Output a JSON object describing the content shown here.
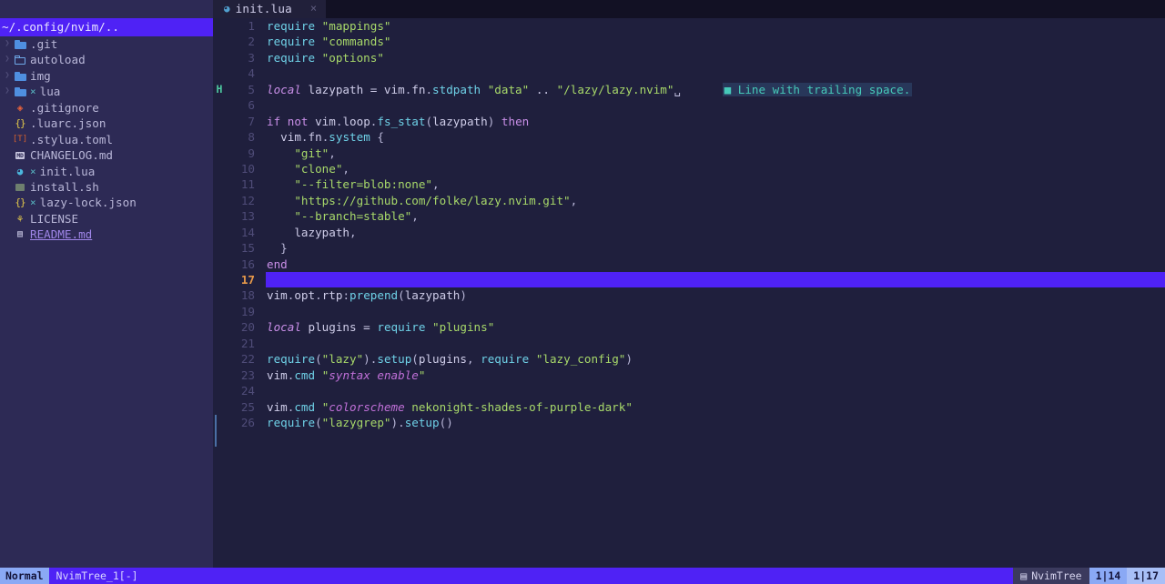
{
  "tabline": {
    "tab": {
      "icon": "lua-file-icon",
      "glyph": "◕",
      "label": "init.lua",
      "close": "×"
    }
  },
  "sidebar": {
    "root": "~/.config/nvim/..",
    "items": [
      {
        "arrow": "❯",
        "icon": "folder-closed-icon",
        "kind": "folder-full",
        "label": ".git",
        "modified": ""
      },
      {
        "arrow": "❯",
        "icon": "folder-open-icon",
        "kind": "folder-open",
        "label": "autoload",
        "modified": ""
      },
      {
        "arrow": "❯",
        "icon": "folder-closed-icon",
        "kind": "folder-full",
        "label": "img",
        "modified": ""
      },
      {
        "arrow": "❯",
        "icon": "folder-closed-icon",
        "kind": "folder-full",
        "label": "lua",
        "modified": "×"
      },
      {
        "arrow": "",
        "icon": "git-icon",
        "kind": "git",
        "label": ".gitignore",
        "modified": "",
        "glyph": "◈"
      },
      {
        "arrow": "",
        "icon": "json-icon",
        "kind": "json",
        "label": ".luarc.json",
        "modified": "",
        "glyph": "{}"
      },
      {
        "arrow": "",
        "icon": "toml-icon",
        "kind": "toml",
        "label": ".stylua.toml",
        "modified": "",
        "glyph": "[T]"
      },
      {
        "arrow": "",
        "icon": "markdown-icon",
        "kind": "md",
        "label": "CHANGELOG.md",
        "modified": "",
        "glyph": "MD"
      },
      {
        "arrow": "",
        "icon": "lua-file-icon",
        "kind": "lua",
        "label": "init.lua",
        "modified": "×",
        "glyph": "◕"
      },
      {
        "arrow": "",
        "icon": "shell-script-icon",
        "kind": "sh",
        "label": "install.sh",
        "modified": "",
        "glyph": ""
      },
      {
        "arrow": "",
        "icon": "json-icon",
        "kind": "json",
        "label": "lazy-lock.json",
        "modified": "×",
        "glyph": "{}"
      },
      {
        "arrow": "",
        "icon": "license-icon",
        "kind": "lic",
        "label": "LICENSE",
        "modified": "",
        "glyph": "⚘"
      },
      {
        "arrow": "",
        "icon": "book-icon",
        "kind": "book",
        "label": "README.md",
        "modified": "",
        "glyph": "▤",
        "link": true
      }
    ]
  },
  "editor": {
    "diagnostic": {
      "marker": "■",
      "text": "Line with trailing space."
    },
    "sign_h": "H",
    "cursor_line": 17,
    "lines": [
      {
        "n": 1,
        "tokens": [
          {
            "t": "require",
            "c": "fn"
          },
          {
            "t": " ",
            "c": "op"
          },
          {
            "t": "\"mappings\"",
            "c": "str"
          }
        ]
      },
      {
        "n": 2,
        "tokens": [
          {
            "t": "require",
            "c": "fn"
          },
          {
            "t": " ",
            "c": "op"
          },
          {
            "t": "\"commands\"",
            "c": "str"
          }
        ]
      },
      {
        "n": 3,
        "tokens": [
          {
            "t": "require",
            "c": "fn"
          },
          {
            "t": " ",
            "c": "op"
          },
          {
            "t": "\"options\"",
            "c": "str"
          }
        ]
      },
      {
        "n": 4,
        "tokens": []
      },
      {
        "n": 5,
        "tokens": [
          {
            "t": "local",
            "c": "kw"
          },
          {
            "t": " lazypath ",
            "c": "id"
          },
          {
            "t": "=",
            "c": "op"
          },
          {
            "t": " vim",
            "c": "id"
          },
          {
            "t": ".",
            "c": "punct"
          },
          {
            "t": "fn",
            "c": "id"
          },
          {
            "t": ".",
            "c": "punct"
          },
          {
            "t": "stdpath",
            "c": "fn"
          },
          {
            "t": " ",
            "c": "op"
          },
          {
            "t": "\"data\"",
            "c": "str"
          },
          {
            "t": " ",
            "c": "op"
          },
          {
            "t": "..",
            "c": "op"
          },
          {
            "t": " ",
            "c": "op"
          },
          {
            "t": "\"/lazy/lazy.nvim\"",
            "c": "str"
          },
          {
            "t": "␣",
            "c": "punct"
          }
        ]
      },
      {
        "n": 6,
        "tokens": []
      },
      {
        "n": 7,
        "tokens": [
          {
            "t": "if",
            "c": "kw2"
          },
          {
            "t": " ",
            "c": "op"
          },
          {
            "t": "not",
            "c": "kw2"
          },
          {
            "t": " vim",
            "c": "id"
          },
          {
            "t": ".",
            "c": "punct"
          },
          {
            "t": "loop",
            "c": "id"
          },
          {
            "t": ".",
            "c": "punct"
          },
          {
            "t": "fs_stat",
            "c": "fn"
          },
          {
            "t": "(",
            "c": "punct"
          },
          {
            "t": "lazypath",
            "c": "id"
          },
          {
            "t": ")",
            "c": "punct"
          },
          {
            "t": " ",
            "c": "op"
          },
          {
            "t": "then",
            "c": "kw2"
          }
        ]
      },
      {
        "n": 8,
        "tokens": [
          {
            "t": "  vim",
            "c": "id"
          },
          {
            "t": ".",
            "c": "punct"
          },
          {
            "t": "fn",
            "c": "id"
          },
          {
            "t": ".",
            "c": "punct"
          },
          {
            "t": "system",
            "c": "fn"
          },
          {
            "t": " ",
            "c": "op"
          },
          {
            "t": "{",
            "c": "punct"
          }
        ]
      },
      {
        "n": 9,
        "tokens": [
          {
            "t": "    ",
            "c": "op"
          },
          {
            "t": "\"git\"",
            "c": "str"
          },
          {
            "t": ",",
            "c": "punct"
          }
        ]
      },
      {
        "n": 10,
        "tokens": [
          {
            "t": "    ",
            "c": "op"
          },
          {
            "t": "\"clone\"",
            "c": "str"
          },
          {
            "t": ",",
            "c": "punct"
          }
        ]
      },
      {
        "n": 11,
        "tokens": [
          {
            "t": "    ",
            "c": "op"
          },
          {
            "t": "\"--filter=blob:none\"",
            "c": "str"
          },
          {
            "t": ",",
            "c": "punct"
          }
        ]
      },
      {
        "n": 12,
        "tokens": [
          {
            "t": "    ",
            "c": "op"
          },
          {
            "t": "\"https://github.com/folke/lazy.nvim.git\"",
            "c": "str"
          },
          {
            "t": ",",
            "c": "punct"
          }
        ]
      },
      {
        "n": 13,
        "tokens": [
          {
            "t": "    ",
            "c": "op"
          },
          {
            "t": "\"--branch=stable\"",
            "c": "str"
          },
          {
            "t": ",",
            "c": "punct"
          }
        ]
      },
      {
        "n": 14,
        "tokens": [
          {
            "t": "    lazypath",
            "c": "id"
          },
          {
            "t": ",",
            "c": "punct"
          }
        ]
      },
      {
        "n": 15,
        "tokens": [
          {
            "t": "  ",
            "c": "op"
          },
          {
            "t": "}",
            "c": "punct"
          }
        ]
      },
      {
        "n": 16,
        "tokens": [
          {
            "t": "end",
            "c": "kw2"
          }
        ]
      },
      {
        "n": 17,
        "tokens": []
      },
      {
        "n": 18,
        "tokens": [
          {
            "t": "vim",
            "c": "id"
          },
          {
            "t": ".",
            "c": "punct"
          },
          {
            "t": "opt",
            "c": "id"
          },
          {
            "t": ".",
            "c": "punct"
          },
          {
            "t": "rtp",
            "c": "id"
          },
          {
            "t": ":",
            "c": "punct"
          },
          {
            "t": "prepend",
            "c": "fn"
          },
          {
            "t": "(",
            "c": "punct"
          },
          {
            "t": "lazypath",
            "c": "id"
          },
          {
            "t": ")",
            "c": "punct"
          }
        ]
      },
      {
        "n": 19,
        "tokens": []
      },
      {
        "n": 20,
        "tokens": [
          {
            "t": "local",
            "c": "kw"
          },
          {
            "t": " plugins ",
            "c": "id"
          },
          {
            "t": "=",
            "c": "op"
          },
          {
            "t": " ",
            "c": "op"
          },
          {
            "t": "require",
            "c": "fn"
          },
          {
            "t": " ",
            "c": "op"
          },
          {
            "t": "\"plugins\"",
            "c": "str"
          }
        ]
      },
      {
        "n": 21,
        "tokens": []
      },
      {
        "n": 22,
        "tokens": [
          {
            "t": "require",
            "c": "fn"
          },
          {
            "t": "(",
            "c": "punct"
          },
          {
            "t": "\"lazy\"",
            "c": "str"
          },
          {
            "t": ")",
            "c": "punct"
          },
          {
            "t": ".",
            "c": "punct"
          },
          {
            "t": "setup",
            "c": "fn"
          },
          {
            "t": "(",
            "c": "punct"
          },
          {
            "t": "plugins",
            "c": "id"
          },
          {
            "t": ",",
            "c": "punct"
          },
          {
            "t": " ",
            "c": "op"
          },
          {
            "t": "require",
            "c": "fn"
          },
          {
            "t": " ",
            "c": "op"
          },
          {
            "t": "\"lazy_config\"",
            "c": "str"
          },
          {
            "t": ")",
            "c": "punct"
          }
        ]
      },
      {
        "n": 23,
        "tokens": [
          {
            "t": "vim",
            "c": "id"
          },
          {
            "t": ".",
            "c": "punct"
          },
          {
            "t": "cmd",
            "c": "fn"
          },
          {
            "t": " ",
            "c": "op"
          },
          {
            "t": "\"",
            "c": "str"
          },
          {
            "t": "syntax enable",
            "c": "istr"
          },
          {
            "t": "\"",
            "c": "str"
          }
        ]
      },
      {
        "n": 24,
        "tokens": []
      },
      {
        "n": 25,
        "tokens": [
          {
            "t": "vim",
            "c": "id"
          },
          {
            "t": ".",
            "c": "punct"
          },
          {
            "t": "cmd",
            "c": "fn"
          },
          {
            "t": " ",
            "c": "op"
          },
          {
            "t": "\"",
            "c": "str"
          },
          {
            "t": "colorscheme",
            "c": "istr"
          },
          {
            "t": " nekonight-shades-of-purple-dark",
            "c": "str"
          },
          {
            "t": "\"",
            "c": "str"
          }
        ]
      },
      {
        "n": 26,
        "tokens": [
          {
            "t": "require",
            "c": "fn"
          },
          {
            "t": "(",
            "c": "punct"
          },
          {
            "t": "\"lazygrep\"",
            "c": "str"
          },
          {
            "t": ")",
            "c": "punct"
          },
          {
            "t": ".",
            "c": "punct"
          },
          {
            "t": "setup",
            "c": "fn"
          },
          {
            "t": "(",
            "c": "punct"
          },
          {
            "t": ")",
            "c": "punct"
          }
        ]
      }
    ]
  },
  "statusline": {
    "mode": "Normal",
    "buffer": "NvimTree_1[-]",
    "file_icon": "▤",
    "file_label": "NvimTree",
    "position_1": "1|14",
    "position_2": "1|17"
  },
  "colors": {
    "editor_bg": "#1f1f3d",
    "sidebar_bg": "#2d2a55",
    "tabline_bg": "#121124",
    "accent_violet": "#4f22f5",
    "status_mode_bg": "#8aa9f5",
    "string_green": "#a8d96a",
    "function_cyan": "#6fd2e8",
    "keyword_purple": "#c98fe8",
    "diagnostic_teal": "#46c8b8",
    "cursor_number_orange": "#e89a4a"
  }
}
